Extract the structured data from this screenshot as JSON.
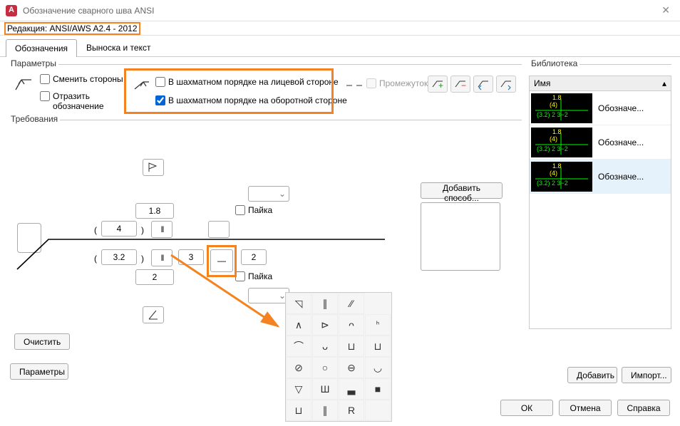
{
  "window": {
    "title": "Обозначение сварного шва ANSI"
  },
  "revision": {
    "text": "Редакция: ANSI/AWS A2.4 - 2012"
  },
  "tabs": {
    "active": "Обозначения",
    "inactive": "Выноска и текст"
  },
  "groups": {
    "params": "Параметры",
    "requirements": "Требования",
    "library": "Библиотека"
  },
  "params": {
    "swap_sides": "Сменить стороны",
    "mirror_label1": "Отразить",
    "mirror_label2": "обозначение",
    "stagger_face": "В шахматном порядке на лицевой стороне",
    "stagger_back": "В шахматном порядке на оборотной стороне",
    "gap": "Промежуток"
  },
  "requirements": {
    "solder1": "Пайка",
    "solder2": "Пайка",
    "val_top": "1.8",
    "paren_open": "(",
    "paren_close": ")",
    "val_4": "4",
    "val_32": "3.2",
    "val_2a": "2",
    "val_3": "3",
    "val_2b": "2",
    "dash": "—",
    "clear_btn": "Очистить",
    "add_method": "Добавить способ...",
    "params_btn": "Параметры"
  },
  "library": {
    "header": "Имя",
    "item_label": "Обозначе...",
    "thumb_top": "1.8",
    "thumb_mid": "(4)",
    "thumb_bot": "(3.2) 2 3−2",
    "add_btn": "Добавить",
    "import_btn": "Импорт..."
  },
  "dialog_buttons": {
    "ok": "ОК",
    "cancel": "Отмена",
    "help": "Справка"
  },
  "palette": {
    "cells": [
      "◹",
      "∥",
      "⁄⁄",
      "∧",
      "⊳",
      "ᴖ",
      "ᑋ",
      "⌒",
      "ᴗ",
      "⊔",
      "⊔",
      "⊘",
      "○",
      "⊖",
      "◡",
      "▽",
      "Ш",
      "▃",
      "■",
      "⊔",
      "∥",
      "R",
      ""
    ]
  }
}
